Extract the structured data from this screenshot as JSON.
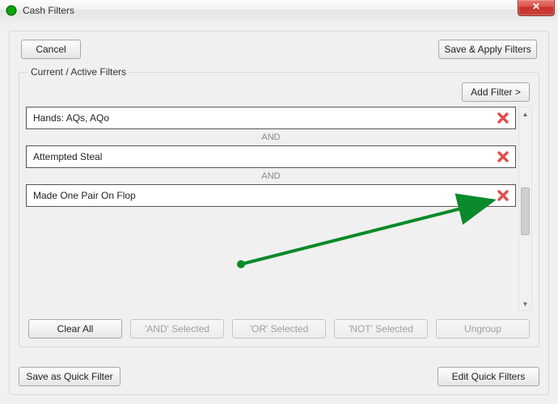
{
  "window": {
    "title": "Cash Filters",
    "close_glyph": "✕"
  },
  "top_buttons": {
    "cancel": "Cancel",
    "save_apply": "Save & Apply Filters"
  },
  "fieldset": {
    "legend": "Current / Active Filters",
    "add_filter": "Add Filter >"
  },
  "filters": [
    {
      "label": "Hands: AQs, AQo"
    },
    {
      "label": "Attempted Steal"
    },
    {
      "label": "Made One Pair On Flop"
    }
  ],
  "separator": "AND",
  "logic_buttons": {
    "clear_all": "Clear All",
    "and_selected": "'AND' Selected",
    "or_selected": "'OR' Selected",
    "not_selected": "'NOT' Selected",
    "ungroup": "Ungroup"
  },
  "bottom_buttons": {
    "save_quick": "Save as Quick Filter",
    "edit_quick": "Edit Quick Filters"
  }
}
